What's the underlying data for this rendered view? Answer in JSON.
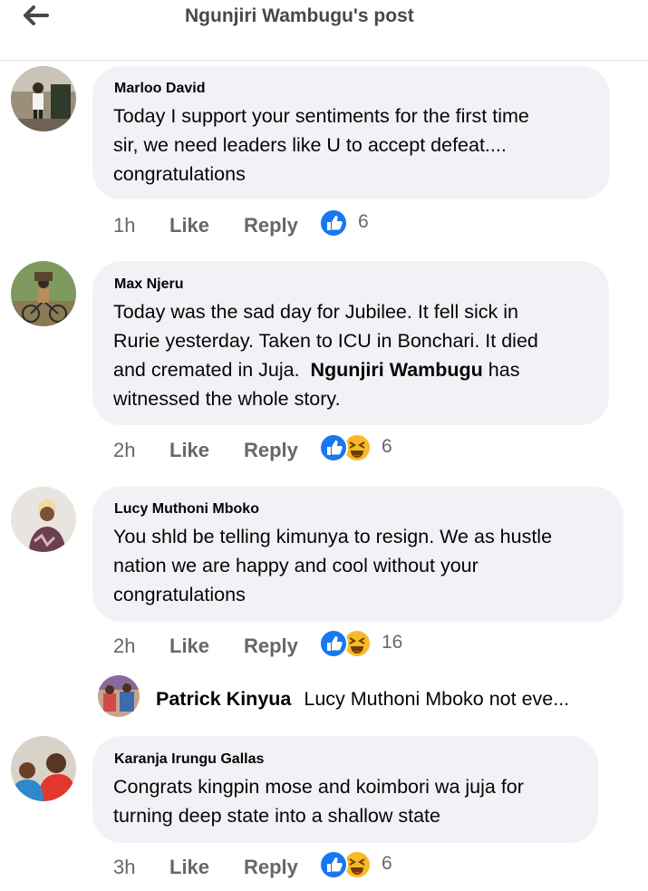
{
  "header": {
    "title": "Ngunjiri Wambugu's post",
    "back_icon": "arrow-left-icon"
  },
  "comments": [
    {
      "author": "Marloo David",
      "lines": [
        "Today I support your sentiments for the first time",
        "sir, we need leaders like U to accept defeat....",
        "congratulations"
      ],
      "time": "1h",
      "like": "Like",
      "reply": "Reply",
      "reactions": [
        "like"
      ],
      "reaction_count": "6"
    },
    {
      "author": "Max Njeru",
      "lines": [
        "Today was the sad day for Jubilee. It fell sick in",
        "Rurie yesterday. Taken to ICU in Bonchari. It died"
      ],
      "line3_before": "and cremated in Juja.",
      "mention": "Ngunjiri Wambugu",
      "line3_after": "has",
      "line4": "witnessed the whole story.",
      "time": "2h",
      "like": "Like",
      "reply": "Reply",
      "reactions": [
        "like",
        "haha"
      ],
      "reaction_count": "6"
    },
    {
      "author": "Lucy Muthoni Mboko",
      "lines": [
        "You shld be telling kimunya to resign. We as hustle",
        "nation we are happy and cool without your",
        "congratulations"
      ],
      "time": "2h",
      "like": "Like",
      "reply": "Reply",
      "reactions": [
        "like",
        "haha"
      ],
      "reaction_count": "16",
      "reply_preview": {
        "author": "Patrick Kinyua",
        "text": "Lucy Muthoni Mboko not eve..."
      }
    },
    {
      "author": "Karanja Irungu Gallas",
      "lines": [
        "Congrats kingpin mose and koimbori wa juja for",
        "turning deep state into a shallow state"
      ],
      "time": "3h",
      "like": "Like",
      "reply": "Reply",
      "reactions": [
        "like",
        "haha"
      ],
      "reaction_count": "6"
    }
  ],
  "colors": {
    "like_blue": "#1877f2",
    "haha_yellow": "#f7b928",
    "bubble": "#f0f2f5",
    "meta": "#65676b"
  }
}
